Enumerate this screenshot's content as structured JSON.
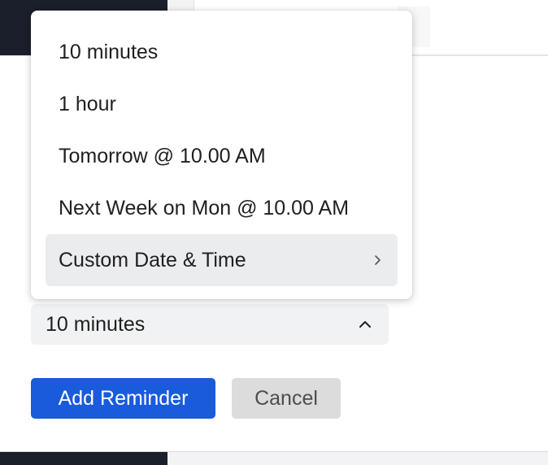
{
  "reminder_menu": {
    "items": [
      {
        "label": "10 minutes"
      },
      {
        "label": "1 hour"
      },
      {
        "label": "Tomorrow @ 10.00 AM"
      },
      {
        "label": "Next Week on Mon @ 10.00 AM"
      },
      {
        "label": "Custom Date & Time",
        "has_submenu": true
      }
    ]
  },
  "reminder_select": {
    "value": "10 minutes"
  },
  "actions": {
    "add_label": "Add Reminder",
    "cancel_label": "Cancel"
  },
  "colors": {
    "primary": "#1a5bdc",
    "secondary_bg": "#dcdcdd",
    "highlight_bg": "#ebecee"
  },
  "icons": {
    "select_chevron": "chevron-up-icon",
    "submenu_arrow": "chevron-right-icon"
  }
}
